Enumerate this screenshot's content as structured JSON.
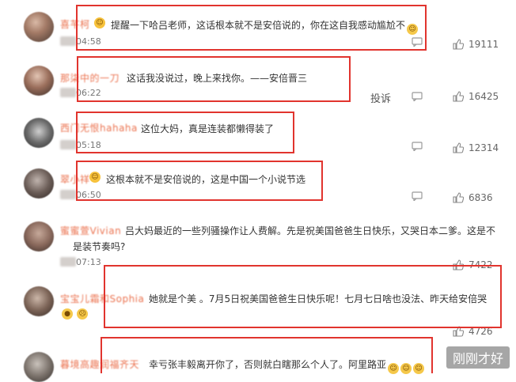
{
  "comments": [
    {
      "name": "喜芊柯",
      "text": "提醒一下哈吕老师，这话根本就不是安倍说的，你在这自我感动尴尬不",
      "time": "04:58",
      "likes": "19111"
    },
    {
      "name": "那柒中的一刀",
      "text": "这话我没说过，晚上来找你。——安倍晋三",
      "time": "06:22",
      "likes": "16425",
      "report": "投诉"
    },
    {
      "name": "西门无恨hahaha",
      "text": "这位大妈，真是连装都懒得装了",
      "time": "05:18",
      "likes": "12314"
    },
    {
      "name": "翠小祥",
      "text": "这根本就不是安倍说的，这是中国一个小说节选",
      "time": "06:50",
      "likes": "6836"
    },
    {
      "name": "蜜蜜萱Vivian",
      "text_line1": "吕大妈最近的一些列骚操作让人费解。先是祝美国爸爸生日快乐，又哭日本二爹。这是不",
      "text_line2": "是装节奏吗?",
      "time": "07:13",
      "likes": "7422"
    },
    {
      "name": "宝宝儿霜和Sophia",
      "text": "她就是个美 。7月5日祝美国爸爸生日快乐呢！七月七日啥也没法、昨天给安倍哭",
      "likes": "4726"
    },
    {
      "name": "暮境高趣润福齐天",
      "text": "幸亏张丰毅离开你了，否则就白瞎那么个人了。阿里路亚"
    }
  ],
  "icons": {
    "like": "thumb-up-icon",
    "reply": "comment-bubble-icon"
  },
  "watermark": "刚刚才好",
  "colors": {
    "name": "#eb7350",
    "highlight_box": "#e1342e"
  }
}
